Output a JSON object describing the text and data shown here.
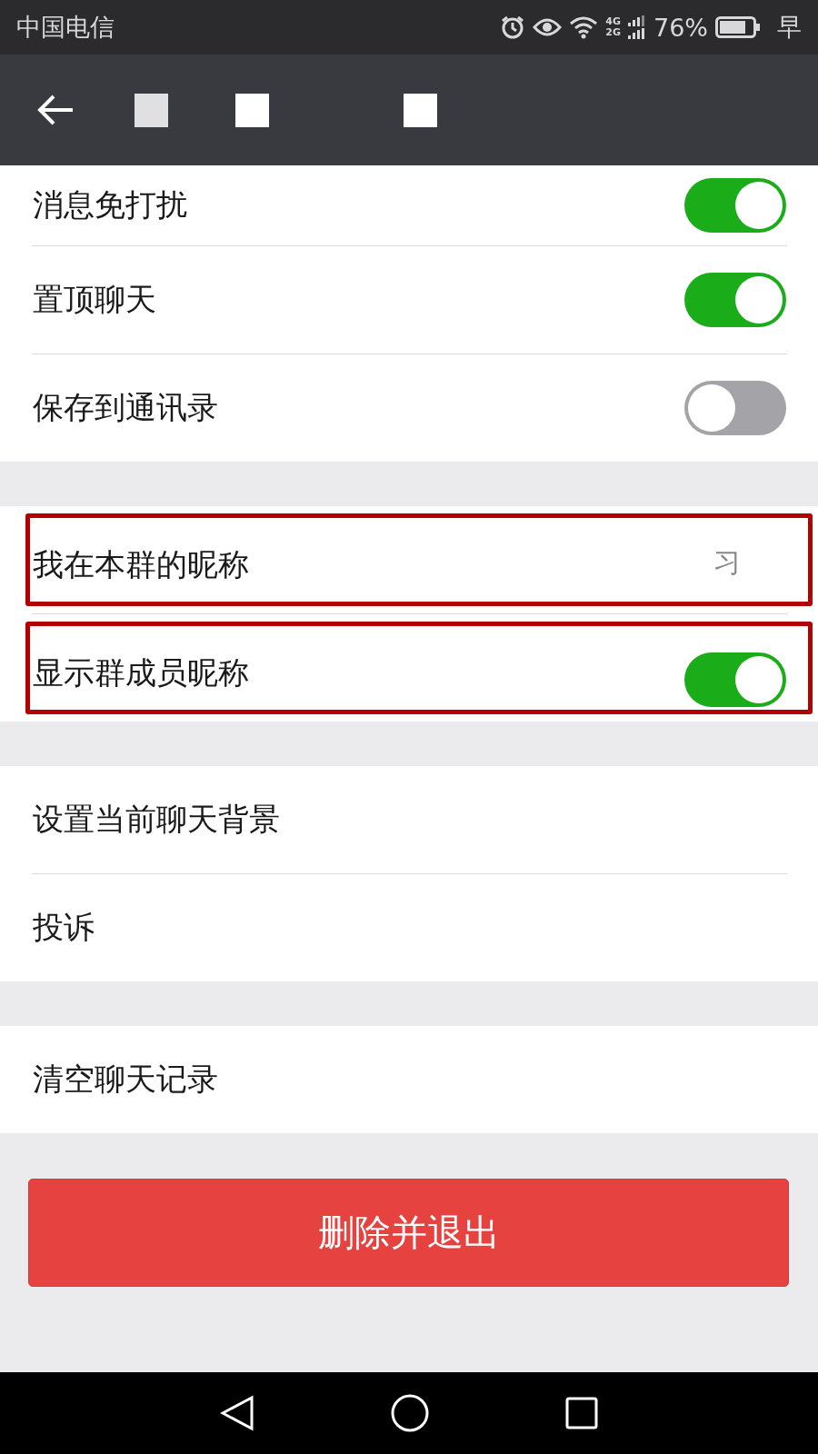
{
  "status_bar": {
    "carrier": "中国电信",
    "network_top": "4G",
    "network_bottom": "2G",
    "battery_percent": "76%",
    "extra": "早"
  },
  "sections": [
    {
      "rows": [
        {
          "kind": "toggle",
          "label": "消息免打扰",
          "on": true,
          "highlighted": false
        },
        {
          "kind": "toggle",
          "label": "置顶聊天",
          "on": true,
          "highlighted": false
        },
        {
          "kind": "toggle",
          "label": "保存到通讯录",
          "on": false,
          "highlighted": false
        }
      ]
    },
    {
      "rows": [
        {
          "kind": "value",
          "label": "我在本群的昵称",
          "value": "习",
          "highlighted": true
        },
        {
          "kind": "toggle",
          "label": "显示群成员昵称",
          "on": true,
          "highlighted": true
        }
      ]
    },
    {
      "rows": [
        {
          "kind": "link",
          "label": "设置当前聊天背景",
          "highlighted": false
        },
        {
          "kind": "link",
          "label": "投诉",
          "highlighted": false
        }
      ]
    },
    {
      "rows": [
        {
          "kind": "link",
          "label": "清空聊天记录",
          "highlighted": false
        }
      ]
    }
  ],
  "danger_button": {
    "label": "删除并退出"
  }
}
